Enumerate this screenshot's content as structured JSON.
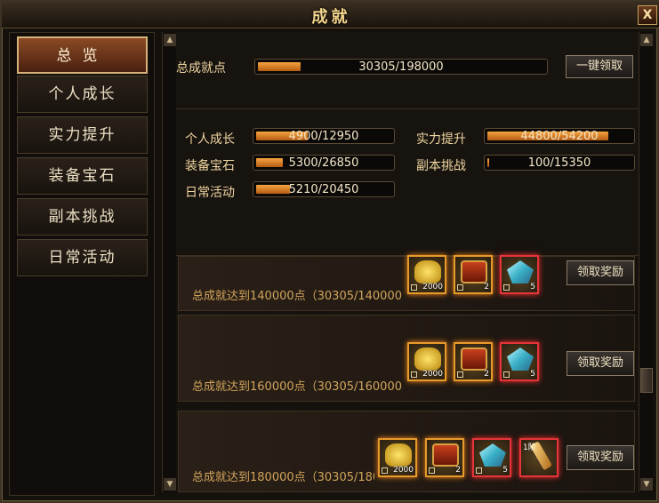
{
  "window": {
    "title": "成就",
    "close_label": "X"
  },
  "sidebar": {
    "items": [
      {
        "label": "总览",
        "active": true
      },
      {
        "label": "个人成长"
      },
      {
        "label": "实力提升"
      },
      {
        "label": "装备宝石"
      },
      {
        "label": "副本挑战"
      },
      {
        "label": "日常活动"
      }
    ]
  },
  "summary": {
    "total_label": "总成就点",
    "total_value": "30305/198000",
    "total_progress": 0.153,
    "claim_all_label": "一键领取",
    "categories": [
      {
        "label": "个人成长",
        "value": "4900/12950",
        "progress": 0.378
      },
      {
        "label": "实力提升",
        "value": "44800/54200",
        "progress": 0.827
      },
      {
        "label": "装备宝石",
        "value": "5300/26850",
        "progress": 0.197
      },
      {
        "label": "副本挑战",
        "value": "100/15350",
        "progress": 0.007
      },
      {
        "label": "日常活动",
        "value": "5210/20450",
        "progress": 0.255
      }
    ]
  },
  "rewards": [
    {
      "text": "总成就达到140000点（30305/140000",
      "claim_label": "领取奖励",
      "items": [
        {
          "icon": "gold-ingot-icon",
          "count": "2000"
        },
        {
          "icon": "treasure-chest-icon",
          "count": "2"
        },
        {
          "icon": "crystal-icon",
          "count": "5"
        }
      ]
    },
    {
      "text": "总成就达到160000点（30305/160000",
      "claim_label": "领取奖励",
      "items": [
        {
          "icon": "gold-ingot-icon",
          "count": "2000"
        },
        {
          "icon": "treasure-chest-icon",
          "count": "2"
        },
        {
          "icon": "crystal-icon",
          "count": "5"
        }
      ]
    },
    {
      "text": "总成就达到180000点（30305/180",
      "claim_label": "领取奖励",
      "items": [
        {
          "icon": "gold-ingot-icon",
          "count": "2000"
        },
        {
          "icon": "treasure-chest-icon",
          "count": "2"
        },
        {
          "icon": "crystal-icon",
          "count": "5"
        },
        {
          "icon": "scroll-icon",
          "count": "",
          "tier": "1阶"
        }
      ]
    }
  ],
  "colors": {
    "accent": "#f6a540",
    "gold_text": "#f0d6a0",
    "reward_text": "#d1a45c"
  }
}
